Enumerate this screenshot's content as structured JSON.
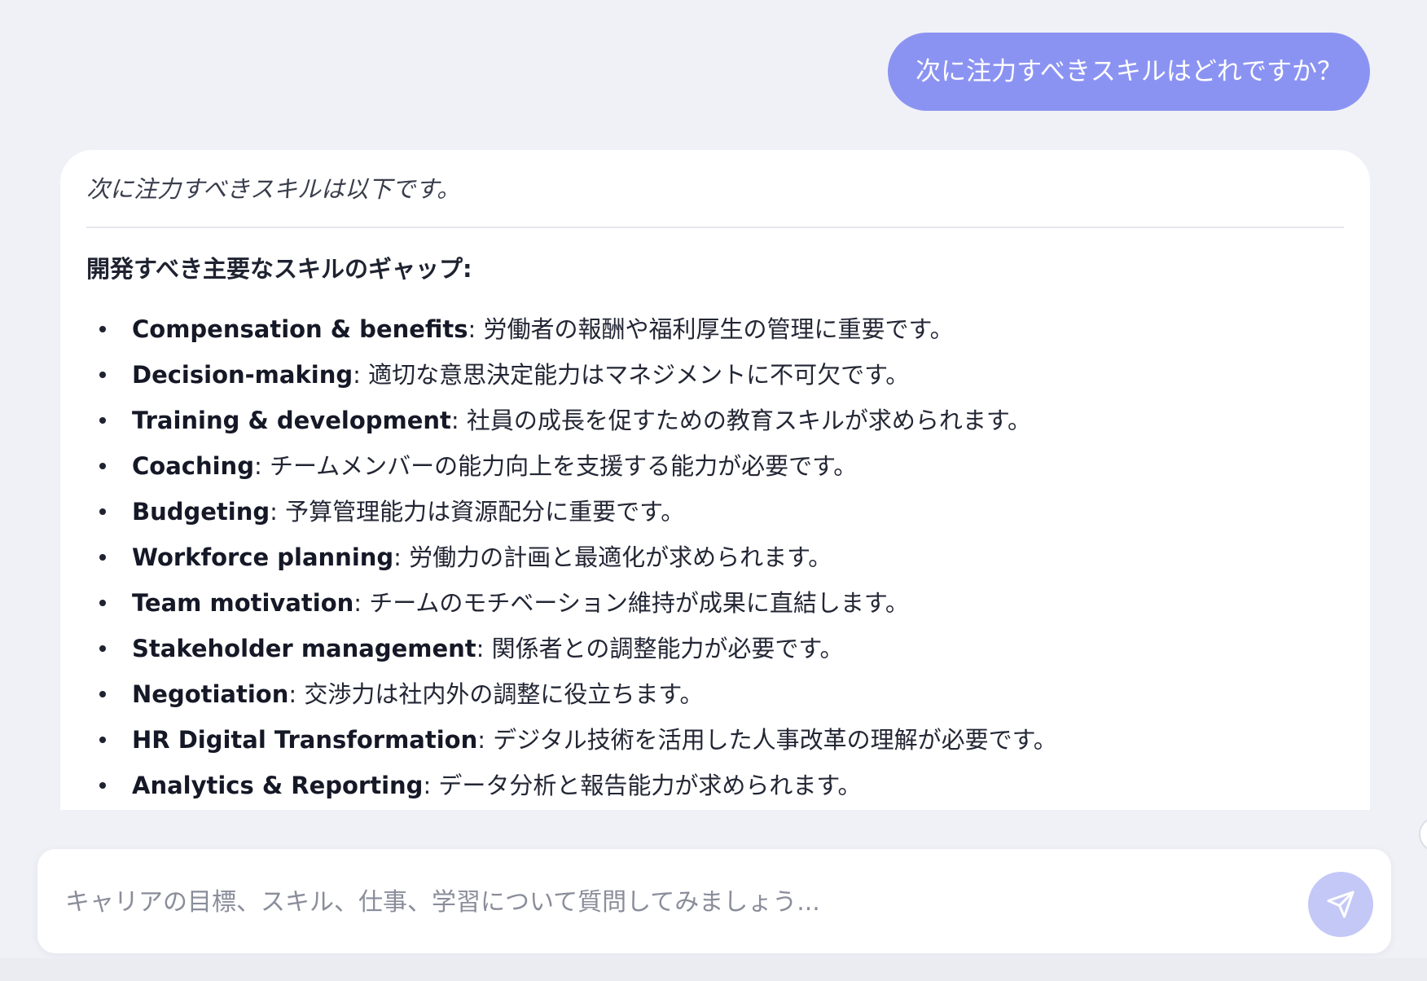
{
  "user_message": "次に注力すべきスキルはどれですか？",
  "assistant": {
    "intro": "次に注力すべきスキルは以下です。",
    "heading": "開発すべき主要なスキルのギャップ:",
    "skills": [
      {
        "name": "Compensation & benefits",
        "desc": ": 労働者の報酬や福利厚生の管理に重要です。"
      },
      {
        "name": "Decision-making",
        "desc": ": 適切な意思決定能力はマネジメントに不可欠です。"
      },
      {
        "name": "Training & development",
        "desc": ": 社員の成長を促すための教育スキルが求められます。"
      },
      {
        "name": "Coaching",
        "desc": ": チームメンバーの能力向上を支援する能力が必要です。"
      },
      {
        "name": "Budgeting",
        "desc": ": 予算管理能力は資源配分に重要です。"
      },
      {
        "name": "Workforce planning",
        "desc": ": 労働力の計画と最適化が求められます。"
      },
      {
        "name": "Team motivation",
        "desc": ": チームのモチベーション維持が成果に直結します。"
      },
      {
        "name": "Stakeholder management",
        "desc": ": 関係者との調整能力が必要です。"
      },
      {
        "name": "Negotiation",
        "desc": ": 交渉力は社内外の調整に役立ちます。"
      },
      {
        "name": "HR Digital Transformation",
        "desc": ": デジタル技術を活用した人事改革の理解が必要です。"
      },
      {
        "name": "Analytics & Reporting",
        "desc": ": データ分析と報告能力が求められます。"
      }
    ]
  },
  "input": {
    "placeholder": "キャリアの目標、スキル、仕事、学習について質問してみましょう..."
  },
  "icons": {
    "send": "send-icon"
  },
  "colors": {
    "user_bubble": "#8b93f2",
    "send_button": "#c4c8f7",
    "background": "#f0f1f7"
  }
}
